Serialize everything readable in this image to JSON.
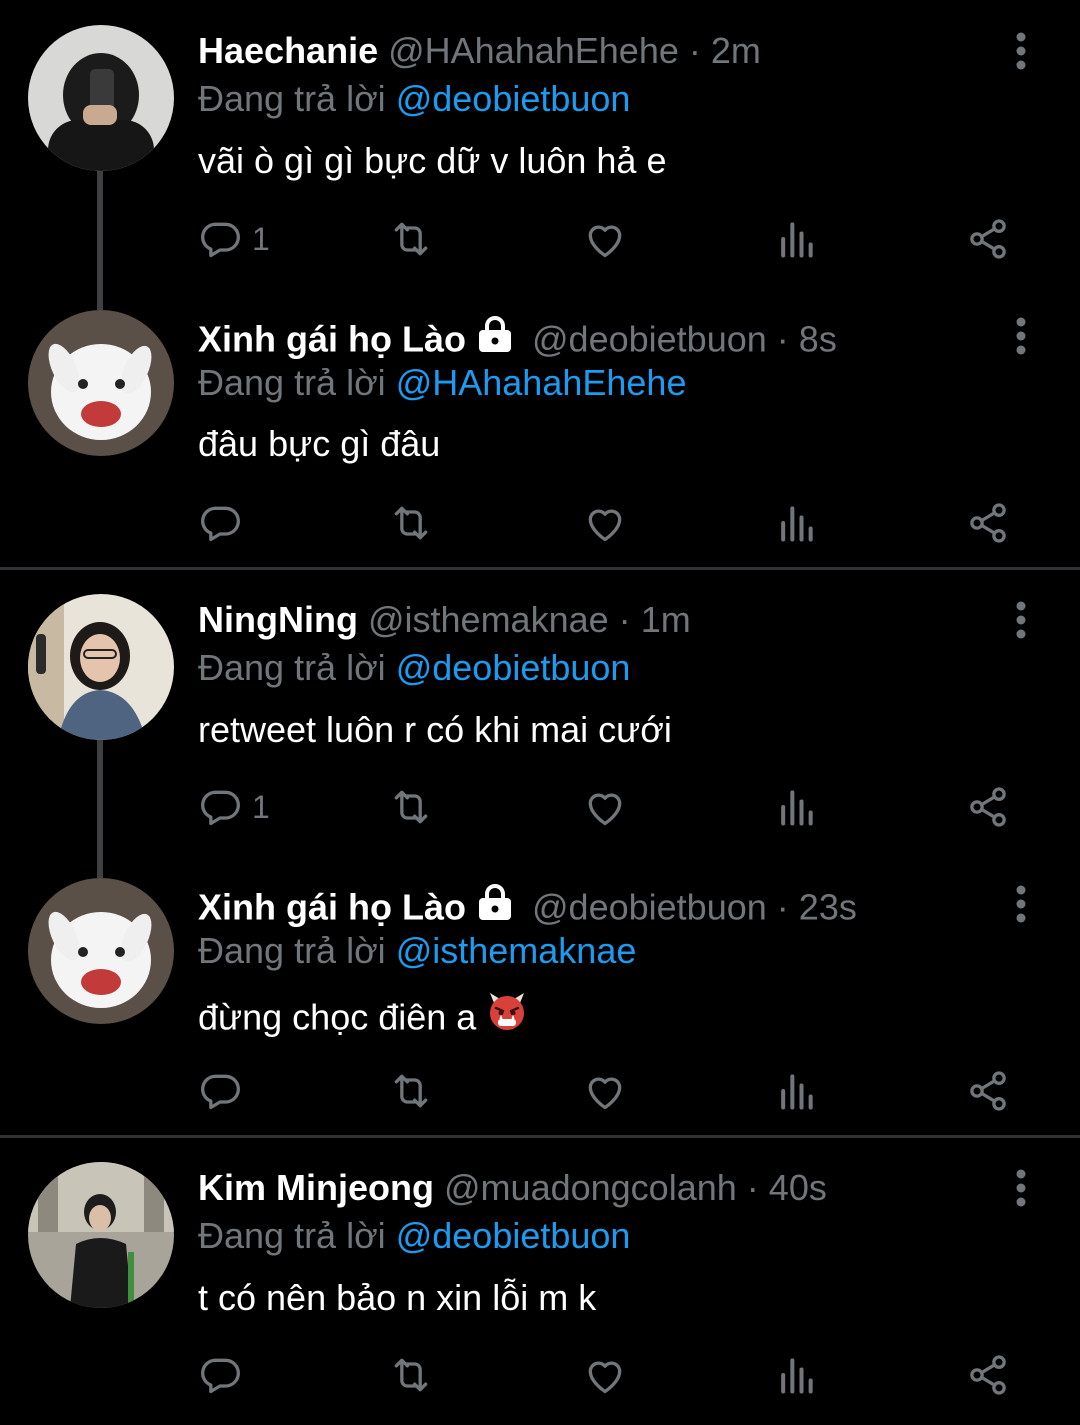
{
  "reply_prefix": "Đang trả lời",
  "tweets": [
    {
      "name": "Haechanie",
      "handle": "@HAhahahEhehe",
      "dot": "·",
      "time": "2m",
      "locked": false,
      "reply_to": "@deobietbuon",
      "text": "vãi ò gì gì bực dữ v luôn hả e",
      "reply_count": "1"
    },
    {
      "name": "Xinh gái họ Lào",
      "handle": "@deobietbuon",
      "dot": "·",
      "time": "8s",
      "locked": true,
      "reply_to": "@HAhahahEhehe",
      "text": "đâu bực gì đâu",
      "reply_count": ""
    },
    {
      "name": "NingNing",
      "handle": "@isthemaknae",
      "dot": "·",
      "time": "1m",
      "locked": false,
      "reply_to": "@deobietbuon",
      "text": "retweet luôn r có khi mai cưới",
      "reply_count": "1"
    },
    {
      "name": "Xinh gái họ Lào",
      "handle": "@deobietbuon",
      "dot": "·",
      "time": "23s",
      "locked": true,
      "reply_to": "@isthemaknae",
      "text": "đừng chọc điên a",
      "emoji": "ogre-emoji",
      "reply_count": ""
    },
    {
      "name": "Kim Minjeong",
      "handle": "@muadongcolanh",
      "dot": "·",
      "time": "40s",
      "locked": false,
      "reply_to": "@deobietbuon",
      "text": "t có nên bảo n xin lỗi m k",
      "reply_count": ""
    }
  ],
  "icons": {
    "reply": "reply-icon",
    "retweet": "retweet-icon",
    "like": "heart-icon",
    "views": "views-icon",
    "share": "share-icon",
    "menu": "more-vertical-icon",
    "lock": "lock-icon"
  },
  "colors": {
    "background": "#000000",
    "text": "#ffffff",
    "secondary": "#71767b",
    "mention": "#1d9bf0",
    "divider": "#2f3336"
  }
}
